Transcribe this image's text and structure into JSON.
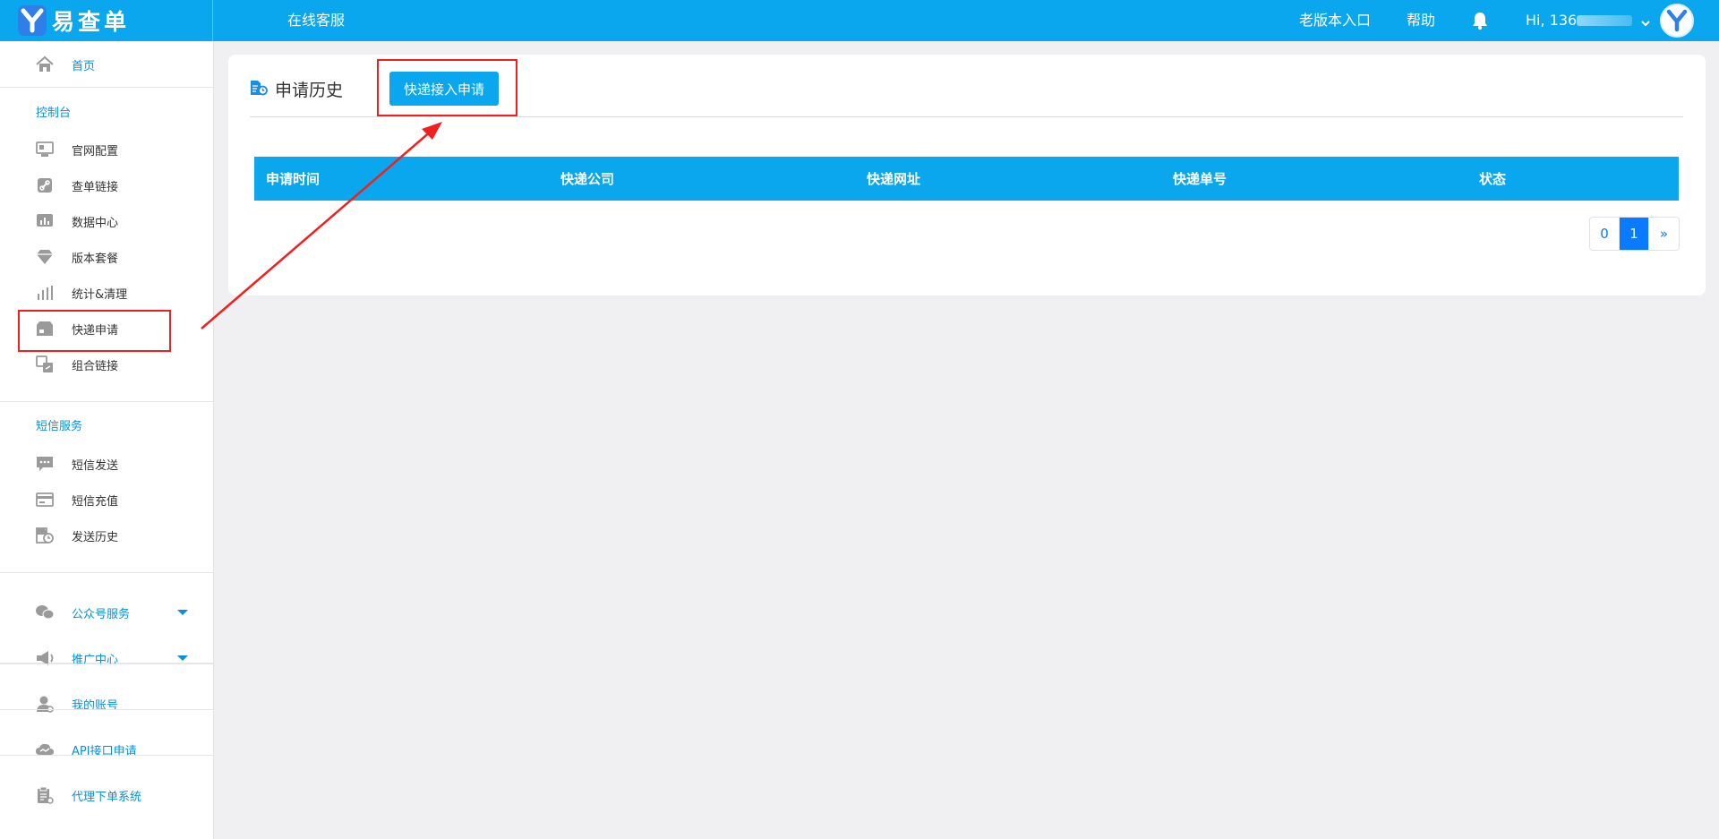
{
  "header": {
    "logo_text": "易查单",
    "service_link": "在线客服",
    "old_version_link": "老版本入口",
    "help_link": "帮助",
    "user_greeting": "Hi, 136"
  },
  "sidebar": {
    "home": "首页",
    "console_title": "控制台",
    "console_items": [
      "官网配置",
      "查单链接",
      "数据中心",
      "版本套餐",
      "统计&清理",
      "快递申请",
      "组合链接"
    ],
    "sms_title": "短信服务",
    "sms_items": [
      "短信发送",
      "短信充值",
      "发送历史"
    ],
    "bottom_items": [
      "公众号服务",
      "推广中心",
      "我的账号",
      "API接口申请",
      "代理下单系统"
    ]
  },
  "main": {
    "title": "申请历史",
    "apply_button": "快递接入申请",
    "table": {
      "columns": [
        "申请时间",
        "快递公司",
        "快递网址",
        "快递单号",
        "状态"
      ],
      "rows": []
    },
    "pagination": [
      "0",
      "1",
      "»"
    ],
    "active_page": "1"
  },
  "colors": {
    "brand": "#0aa6ee",
    "link": "#0a8fe0",
    "pager_active": "#0a7bff",
    "annotation": "#f02020"
  }
}
